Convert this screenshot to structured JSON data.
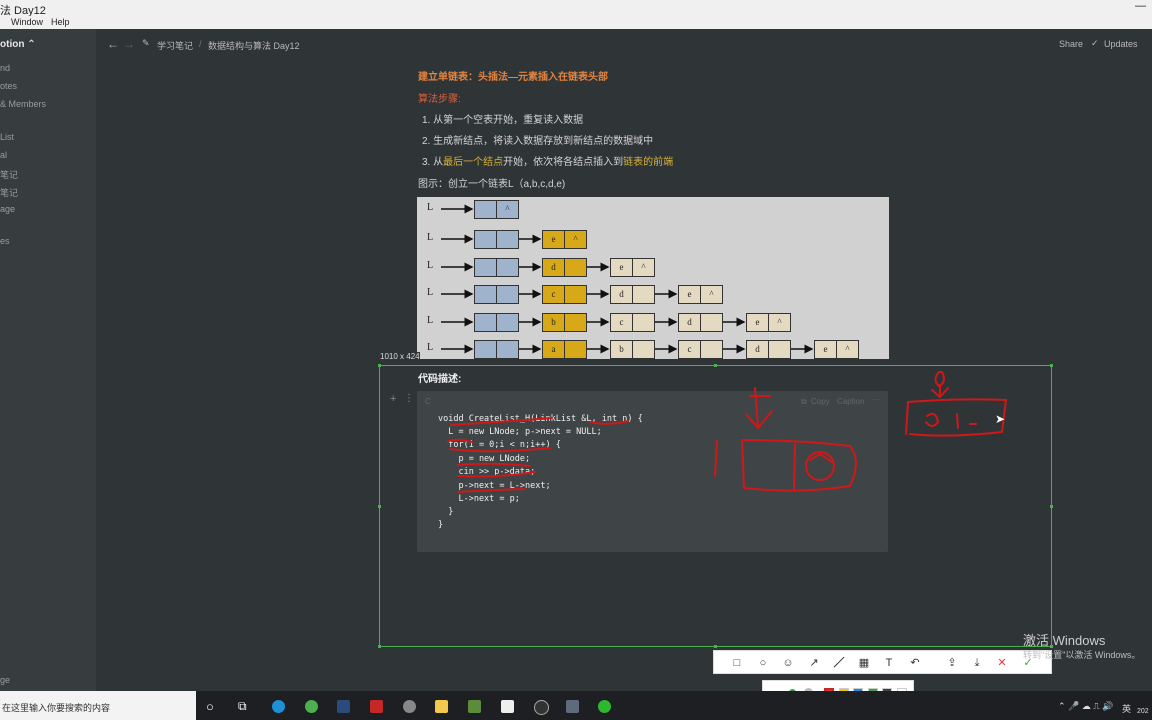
{
  "window": {
    "title": "法 Day12",
    "menu": [
      "Window",
      "Help"
    ]
  },
  "sidebar": {
    "workspace": "otion ⌃",
    "items": [
      "nd",
      "otes",
      "& Members",
      "List",
      "al",
      "笔记",
      "笔记",
      "age",
      "es"
    ],
    "bottom": "ge"
  },
  "topbar": {
    "breadcrumb": [
      "学习笔记",
      "数据结构与算法 Day12"
    ],
    "share": "Share",
    "updates": "Updates"
  },
  "content": {
    "heading": "建立单链表：头插法—元素插入在链表头部",
    "algo_label": "算法步骤:",
    "steps": [
      "1.  从第一个空表开始，重复读入数据",
      "2.  生成新结点，将读入数据存放到新结点的数据域中"
    ],
    "step3": {
      "prefix": "3.  从",
      "highlight1": "最后一个结点",
      "middle": "开始，依次将各结点插入到",
      "highlight2": "链表的前端"
    },
    "figure_caption": "图示：创立一个链表L（a,b,c,d,e)",
    "code_label": "代码描述:",
    "code_lang": "C",
    "code_actions": [
      "Copy",
      "Caption",
      "···"
    ],
    "code": [
      "voidd CreateList_H(LinkList &L, int n) {",
      "  L = new LNode; p->next = NULL;",
      "  for(i = 0;i < n;i++) {",
      "    p = new LNode;",
      "    cin >> p->data;",
      "    p->next = L->next;",
      "    L->next = p;",
      "  }",
      "}"
    ]
  },
  "diagram": {
    "row_label": "L",
    "null_mark": "^",
    "rows": [
      [],
      [
        "e"
      ],
      [
        "d",
        "e"
      ],
      [
        "c",
        "d",
        "e"
      ],
      [
        "b",
        "c",
        "d",
        "e"
      ],
      [
        "a",
        "b",
        "c",
        "d",
        "e"
      ]
    ]
  },
  "screenshot_tool": {
    "size_label": "1010 x 424",
    "colors": [
      "#e53935",
      "#f4c20d",
      "#1e88e5",
      "#43a047",
      "#444444",
      "#ffffff"
    ]
  },
  "watermark": {
    "line1": "激活 Windows",
    "line2": "转到\"设置\"以激活 Windows。"
  },
  "taskbar": {
    "search_placeholder": "在这里输入你要搜索的内容",
    "lang": "英",
    "clock_partial": "202"
  }
}
